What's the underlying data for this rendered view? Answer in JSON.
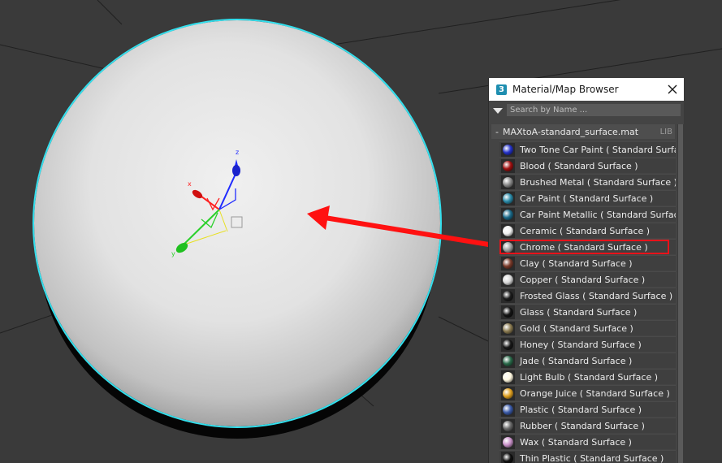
{
  "browser": {
    "title": "Material/Map Browser",
    "app_icon_text": "3",
    "search_placeholder": "Search by Name ...",
    "library": {
      "toggle": "-",
      "name": "MAXtoA-standard_surface.mat",
      "tag": "LIB"
    },
    "items": [
      {
        "label": "Two Tone Car Paint  ( Standard Surface )",
        "color": "#2432c8",
        "icon": "material-sphere-icon"
      },
      {
        "label": "Blood  ( Standard Surface )",
        "color": "#a01010",
        "icon": "material-sphere-icon"
      },
      {
        "label": "Brushed Metal  ( Standard Surface )",
        "color": "#8a8a8a",
        "icon": "material-sphere-icon"
      },
      {
        "label": "Car Paint  ( Standard Surface )",
        "color": "#2a8aa8",
        "icon": "material-sphere-icon"
      },
      {
        "label": "Car Paint Metallic  ( Standard Surface )",
        "color": "#1a6a8a",
        "icon": "material-sphere-icon"
      },
      {
        "label": "Ceramic  ( Standard Surface )",
        "color": "#f0f0f0",
        "icon": "material-sphere-icon"
      },
      {
        "label": "Chrome  ( Standard Surface )",
        "color": "#a0a0a0",
        "icon": "material-sphere-icon"
      },
      {
        "label": "Clay  ( Standard Surface )",
        "color": "#7a3a2a",
        "icon": "material-sphere-icon"
      },
      {
        "label": "Copper  ( Standard Surface )",
        "color": "#d8d8d8",
        "icon": "material-sphere-icon"
      },
      {
        "label": "Frosted Glass  ( Standard Surface )",
        "color": "#1c1c1c",
        "icon": "material-sphere-icon"
      },
      {
        "label": "Glass  ( Standard Surface )",
        "color": "#141414",
        "icon": "material-sphere-icon"
      },
      {
        "label": "Gold  ( Standard Surface )",
        "color": "#8a7a50",
        "icon": "material-sphere-icon"
      },
      {
        "label": "Honey  ( Standard Surface )",
        "color": "#181818",
        "icon": "material-sphere-icon"
      },
      {
        "label": "Jade  ( Standard Surface )",
        "color": "#2a6a4a",
        "icon": "material-sphere-icon"
      },
      {
        "label": "Light Bulb  ( Standard Surface )",
        "color": "#fff8e0",
        "icon": "material-sphere-icon"
      },
      {
        "label": "Orange Juice  ( Standard Surface )",
        "color": "#e0a020",
        "icon": "material-sphere-icon"
      },
      {
        "label": "Plastic  ( Standard Surface )",
        "color": "#3a5aa8",
        "icon": "material-sphere-icon"
      },
      {
        "label": "Rubber  ( Standard Surface )",
        "color": "#6a6a6a",
        "icon": "material-sphere-icon"
      },
      {
        "label": "Wax  ( Standard Surface )",
        "color": "#c890c8",
        "icon": "material-sphere-icon"
      },
      {
        "label": "Thin Plastic  ( Standard Surface )",
        "color": "#101010",
        "icon": "material-sphere-icon"
      }
    ],
    "selected_item": "Chrome  ( Standard Surface )"
  },
  "viewport": {
    "background_color": "#3a3a3a",
    "selection_outline_color": "#33e0ee",
    "annotation_arrow_color": "#ff1111",
    "gizmo_axis_labels": [
      "z",
      "x",
      "y"
    ]
  }
}
